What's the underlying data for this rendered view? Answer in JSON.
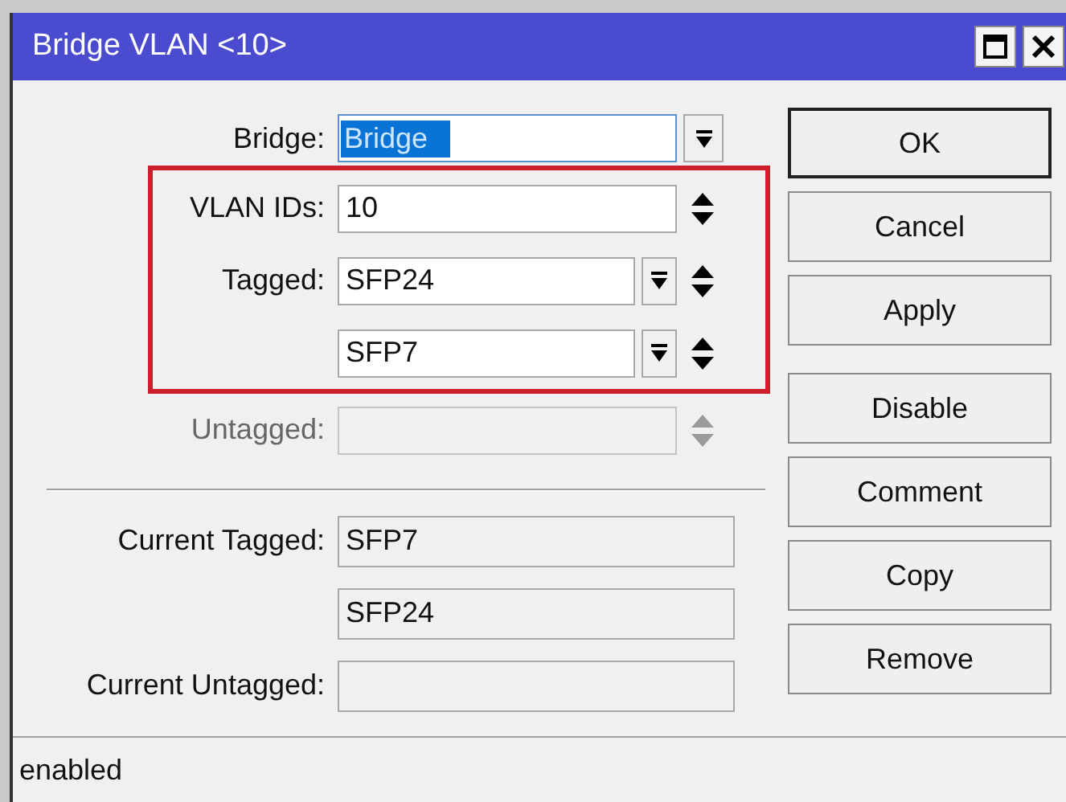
{
  "window": {
    "title": "Bridge VLAN <10>"
  },
  "settings": [
    {
      "label": "Bridge:",
      "value": "Bridge",
      "selected": true,
      "dropdown": true,
      "spinner": false,
      "disabled": false,
      "highlighted": false
    },
    {
      "label": "VLAN IDs:",
      "value": "10",
      "selected": false,
      "dropdown": false,
      "spinner": true,
      "disabled": false,
      "highlighted": true
    },
    {
      "label": "Tagged:",
      "value": "SFP24",
      "selected": false,
      "dropdown": true,
      "spinner": true,
      "disabled": false,
      "highlighted": true
    },
    {
      "value": "SFP7",
      "selected": false,
      "dropdown": true,
      "spinner": true,
      "disabled": false,
      "highlighted": true
    },
    {
      "label": "Untagged:",
      "selected": false,
      "dropdown": false,
      "spinner": true,
      "disabled": true,
      "highlighted": false
    }
  ],
  "current": [
    {
      "label": "Current Tagged:",
      "value": "SFP7"
    },
    {
      "value": "SFP24"
    },
    {
      "label": "Current Untagged:"
    }
  ],
  "button_groups": [
    {
      "buttons": [
        {
          "label": "OK",
          "default": true
        },
        {
          "label": "Cancel",
          "default": false
        },
        {
          "label": "Apply",
          "default": false
        }
      ]
    },
    {
      "buttons": [
        {
          "label": "Disable",
          "default": false
        },
        {
          "label": "Comment",
          "default": false
        },
        {
          "label": "Copy",
          "default": false
        },
        {
          "label": "Remove",
          "default": false
        }
      ]
    }
  ],
  "status_bar": {
    "text": "enabled"
  }
}
